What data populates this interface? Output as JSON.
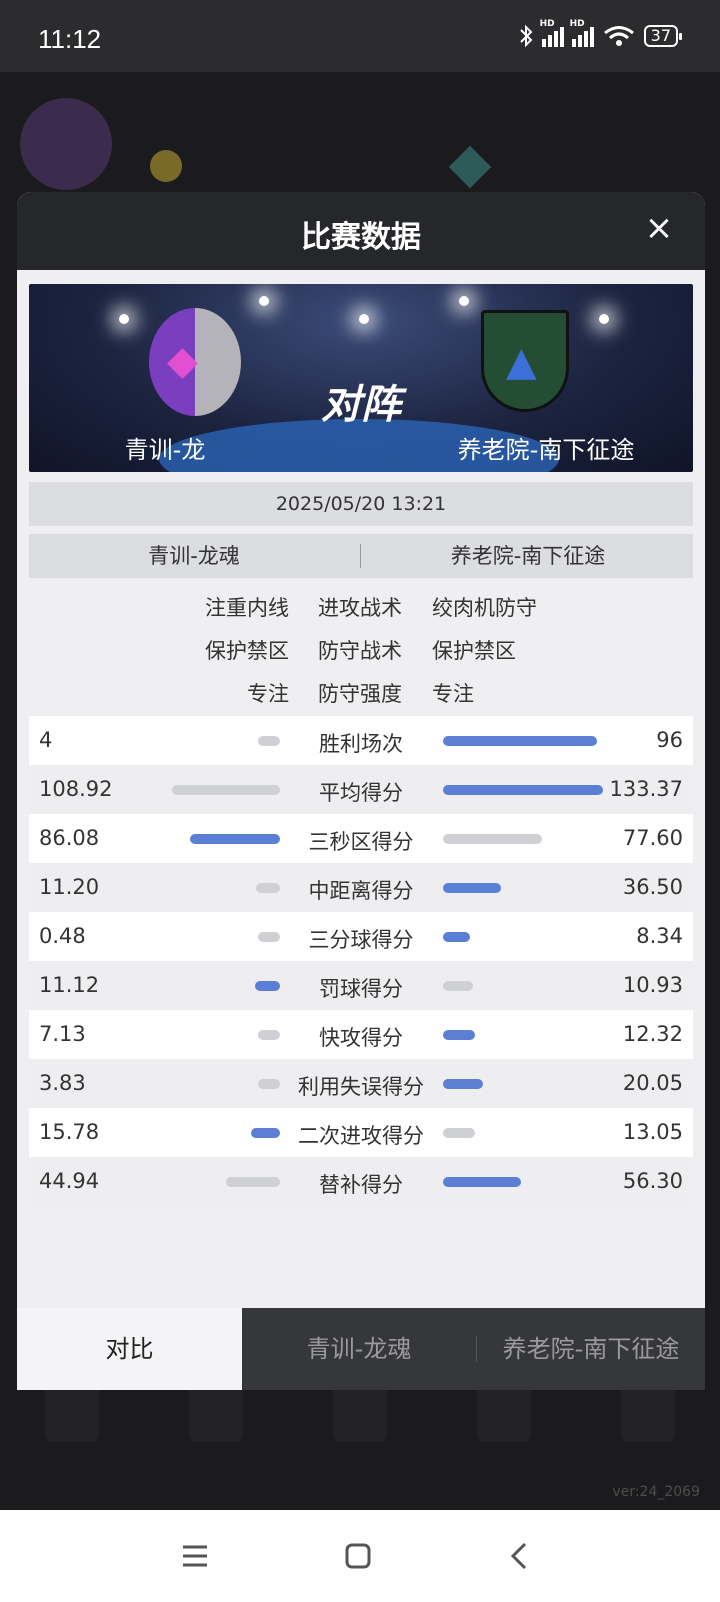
{
  "status_bar": {
    "time": "11:12",
    "battery": "37",
    "hd_label": "HD"
  },
  "background": {
    "version": "ver:24_2069"
  },
  "modal": {
    "title": "比赛数据",
    "close_icon": "×",
    "banner": {
      "vs_text": "对阵",
      "home_team": "青训-龙魂",
      "away_team": "养老院-南下征途"
    },
    "date": "2025/05/20 13:21",
    "team_header": {
      "home": "青训-龙魂",
      "away": "养老院-南下征途"
    },
    "tactics": [
      {
        "home": "注重内线",
        "label": "进攻战术",
        "away": "绞肉机防守"
      },
      {
        "home": "保护禁区",
        "label": "防守战术",
        "away": "保护禁区"
      },
      {
        "home": "专注",
        "label": "防守强度",
        "away": "专注"
      }
    ],
    "stats": [
      {
        "label": "胜利场次",
        "home": "4",
        "away": "96",
        "home_ratio": 0.04,
        "away_ratio": 0.96
      },
      {
        "label": "平均得分",
        "home": "108.92",
        "away": "133.37",
        "home_ratio": 0.82,
        "away_ratio": 1.0
      },
      {
        "label": "三秒区得分",
        "home": "86.08",
        "away": "77.60",
        "home_ratio": 0.68,
        "away_ratio": 0.62
      },
      {
        "label": "中距离得分",
        "home": "11.20",
        "away": "36.50",
        "home_ratio": 0.18,
        "away_ratio": 0.36
      },
      {
        "label": "三分球得分",
        "home": "0.48",
        "away": "8.34",
        "home_ratio": 0.12,
        "away_ratio": 0.17
      },
      {
        "label": "罚球得分",
        "home": "11.12",
        "away": "10.93",
        "home_ratio": 0.19,
        "away_ratio": 0.19
      },
      {
        "label": "快攻得分",
        "home": "7.13",
        "away": "12.32",
        "home_ratio": 0.17,
        "away_ratio": 0.2
      },
      {
        "label": "利用失误得分",
        "home": "3.83",
        "away": "20.05",
        "home_ratio": 0.14,
        "away_ratio": 0.25
      },
      {
        "label": "二次进攻得分",
        "home": "15.78",
        "away": "13.05",
        "home_ratio": 0.22,
        "away_ratio": 0.2
      },
      {
        "label": "替补得分",
        "home": "44.94",
        "away": "56.30",
        "home_ratio": 0.41,
        "away_ratio": 0.49
      }
    ],
    "tabs": [
      "对比",
      "青训-龙魂",
      "养老院-南下征途"
    ]
  },
  "colors": {
    "bar_win": "#5b7fd4",
    "bar_lose": "#cfd0d3",
    "header_bg": "#26272a",
    "modal_bg": "#efeff1"
  },
  "nav_icons": [
    "menu-icon",
    "home-icon",
    "back-icon"
  ]
}
